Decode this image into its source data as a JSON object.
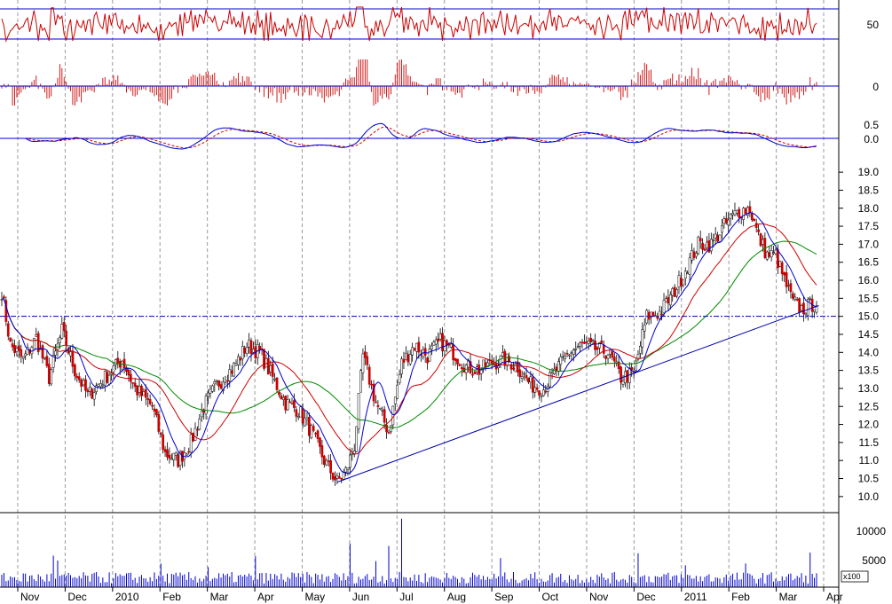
{
  "chart_data": {
    "type": "candlestick",
    "colors": {
      "candle": "#cc0000",
      "ma_fast": "#0000cc",
      "ma_mid": "#cc0000",
      "ma_slow": "#008800",
      "trendline": "#0000aa",
      "volume": "#0000cc",
      "grid": "#999999",
      "panel_line": "#0000cc"
    },
    "x_labels": [
      "Nov",
      "Dec",
      "2010",
      "Feb",
      "Mar",
      "Apr",
      "May",
      "Jun",
      "Jul",
      "Aug",
      "Sep",
      "Oct",
      "Nov",
      "Dec",
      "2011",
      "Feb",
      "Mar",
      "Apr"
    ],
    "price_panel": {
      "y_ticks": [
        "19.0",
        "18.5",
        "18.0",
        "17.5",
        "17.0",
        "16.5",
        "16.0",
        "15.5",
        "15.0",
        "14.5",
        "14.0",
        "13.5",
        "13.0",
        "12.5",
        "12.0",
        "11.5",
        "11.0",
        "10.5",
        "10.0"
      ],
      "ylim": [
        9.75,
        19.2
      ],
      "key_points": [
        [
          0,
          15.7
        ],
        [
          4,
          14.2
        ],
        [
          10,
          13.8
        ],
        [
          16,
          14.4
        ],
        [
          22,
          13.3
        ],
        [
          28,
          14.6
        ],
        [
          34,
          13.5
        ],
        [
          40,
          12.8
        ],
        [
          48,
          13.3
        ],
        [
          56,
          13.8
        ],
        [
          62,
          13.0
        ],
        [
          70,
          12.5
        ],
        [
          76,
          11.2
        ],
        [
          82,
          11.0
        ],
        [
          88,
          11.5
        ],
        [
          94,
          12.5
        ],
        [
          100,
          13.1
        ],
        [
          108,
          13.6
        ],
        [
          114,
          14.2
        ],
        [
          120,
          14.0
        ],
        [
          126,
          13.3
        ],
        [
          132,
          12.6
        ],
        [
          138,
          12.4
        ],
        [
          144,
          11.8
        ],
        [
          150,
          11.0
        ],
        [
          156,
          10.4
        ],
        [
          160,
          10.7
        ],
        [
          164,
          11.4
        ],
        [
          168,
          13.9
        ],
        [
          174,
          12.6
        ],
        [
          180,
          11.8
        ],
        [
          186,
          13.7
        ],
        [
          192,
          14.2
        ],
        [
          198,
          13.9
        ],
        [
          204,
          14.3
        ],
        [
          210,
          14.0
        ],
        [
          216,
          13.6
        ],
        [
          222,
          13.5
        ],
        [
          228,
          13.7
        ],
        [
          234,
          13.8
        ],
        [
          240,
          13.6
        ],
        [
          246,
          13.1
        ],
        [
          252,
          13.0
        ],
        [
          258,
          13.5
        ],
        [
          264,
          14.0
        ],
        [
          270,
          14.2
        ],
        [
          276,
          14.1
        ],
        [
          282,
          14.0
        ],
        [
          288,
          13.3
        ],
        [
          294,
          13.4
        ],
        [
          300,
          15.0
        ],
        [
          306,
          15.1
        ],
        [
          312,
          15.6
        ],
        [
          318,
          16.3
        ],
        [
          324,
          17.0
        ],
        [
          330,
          17.0
        ],
        [
          336,
          17.5
        ],
        [
          342,
          17.9
        ],
        [
          348,
          18.0
        ],
        [
          352,
          17.2
        ],
        [
          356,
          16.7
        ],
        [
          360,
          16.7
        ],
        [
          364,
          16.0
        ],
        [
          368,
          15.4
        ],
        [
          372,
          15.2
        ],
        [
          376,
          15.3
        ],
        [
          379,
          15.4
        ]
      ],
      "moving_averages": [
        {
          "color": "#0000cc",
          "period": 10
        },
        {
          "color": "#cc0000",
          "period": 25
        },
        {
          "color": "#008800",
          "period": 50
        }
      ],
      "support_line": {
        "y": 15.0
      },
      "trend_line": {
        "from": [
          156,
          10.4
        ],
        "to": [
          380,
          15.3
        ]
      }
    },
    "volume_panel": {
      "y_ticks": [
        "10000",
        "5000"
      ],
      "ylim": [
        0,
        12000
      ],
      "unit_label": "x100",
      "spikes": [
        [
          24,
          5200
        ],
        [
          26,
          4400
        ],
        [
          74,
          3900
        ],
        [
          96,
          3300
        ],
        [
          118,
          5100
        ],
        [
          162,
          7200
        ],
        [
          174,
          4300
        ],
        [
          180,
          6800
        ],
        [
          186,
          11300
        ],
        [
          232,
          4800
        ],
        [
          296,
          5600
        ],
        [
          318,
          3600
        ],
        [
          346,
          3900
        ],
        [
          376,
          5700
        ]
      ]
    },
    "rsi_panel": {
      "y_ticks": [
        "50"
      ],
      "bands": [
        70,
        30
      ]
    },
    "histogram_panel": {
      "y_ticks": [
        "0"
      ]
    },
    "macd_panel": {
      "y_ticks": [
        "0.5",
        "0.0"
      ]
    }
  }
}
